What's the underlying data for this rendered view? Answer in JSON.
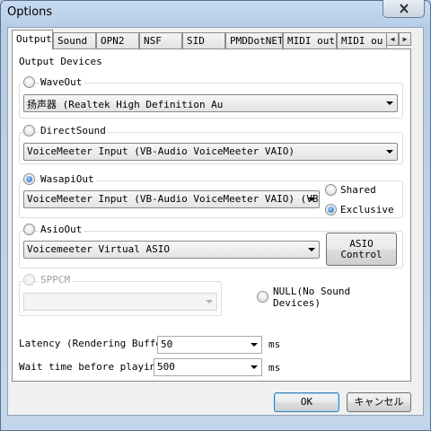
{
  "window": {
    "title": "Options"
  },
  "tabs": [
    "Output",
    "Sound",
    "OPN2",
    "NSF",
    "SID",
    "PMDDotNET",
    "MIDI out",
    "MIDI ou"
  ],
  "output": {
    "devices_label": "Output Devices",
    "waveout": {
      "label": "WaveOut",
      "selected": false,
      "device": "扬声器 (Realtek High Definition Au"
    },
    "directsound": {
      "label": "DirectSound",
      "selected": false,
      "device": "VoiceMeeter Input (VB-Audio VoiceMeeter VAIO)"
    },
    "wasapiout": {
      "label": "WasapiOut",
      "selected": true,
      "device": "VoiceMeeter Input (VB-Audio VoiceMeeter VAIO) (VB-A",
      "shared_label": "Shared",
      "exclusive_label": "Exclusive",
      "mode": "Exclusive"
    },
    "asioout": {
      "label": "AsioOut",
      "selected": false,
      "device": "Voicemeeter Virtual ASIO",
      "control_button": "ASIO\nControl"
    },
    "sppcm": {
      "label": "SPPCM",
      "selected": false,
      "enabled": false,
      "device": ""
    },
    "null": {
      "label": "NULL(No Sound\nDevices)",
      "selected": false
    },
    "latency": {
      "label": "Latency (Rendering Buffer)",
      "value": "50",
      "unit": "ms"
    },
    "wait": {
      "label": "Wait time before playing",
      "value": "500",
      "unit": "ms"
    }
  },
  "buttons": {
    "ok": "OK",
    "cancel": "キャンセル"
  }
}
